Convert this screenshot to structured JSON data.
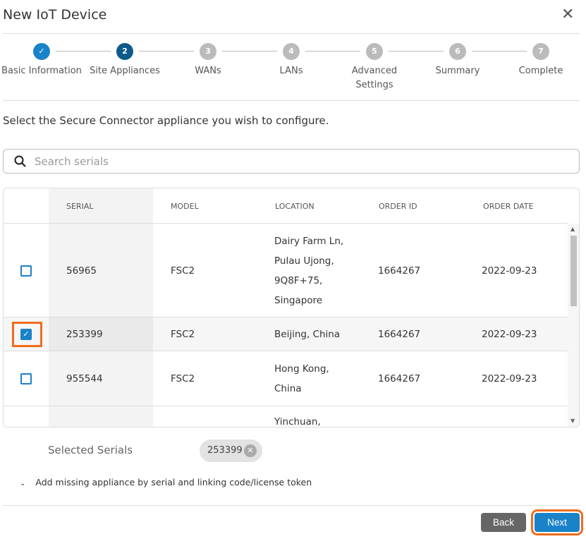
{
  "dialog": {
    "title": "New IoT Device",
    "close_icon": "close-icon"
  },
  "stepper": [
    {
      "num": "✓",
      "label": "Basic Information",
      "state": "done"
    },
    {
      "num": "2",
      "label": "Site Appliances",
      "state": "active"
    },
    {
      "num": "3",
      "label": "WANs",
      "state": "pending"
    },
    {
      "num": "4",
      "label": "LANs",
      "state": "pending"
    },
    {
      "num": "5",
      "label": "Advanced Settings",
      "state": "pending"
    },
    {
      "num": "6",
      "label": "Summary",
      "state": "pending"
    },
    {
      "num": "7",
      "label": "Complete",
      "state": "pending"
    }
  ],
  "prompt": "Select the Secure Connector appliance you wish to configure.",
  "search": {
    "placeholder": "Search serials",
    "value": ""
  },
  "table": {
    "headers": [
      "SERIAL",
      "MODEL",
      "LOCATION",
      "ORDER ID",
      "ORDER DATE"
    ],
    "rows": [
      {
        "checked": false,
        "serial": "56965",
        "model": "FSC2",
        "location": [
          "Dairy Farm Ln,",
          "Pulau Ujong,",
          "9Q8F+75,",
          "Singapore"
        ],
        "order_id": "1664267",
        "order_date": "2022-09-23"
      },
      {
        "checked": true,
        "serial": "253399",
        "model": "FSC2",
        "location": [
          "Beijing, China"
        ],
        "order_id": "1664267",
        "order_date": "2022-09-23"
      },
      {
        "checked": false,
        "serial": "955544",
        "model": "FSC2",
        "location": [
          "Hong Kong,",
          "China"
        ],
        "order_id": "1664267",
        "order_date": "2022-09-23"
      },
      {
        "checked": false,
        "serial": "",
        "model": "",
        "location": [
          "Yinchuan,"
        ],
        "order_id": "",
        "order_date": ""
      }
    ]
  },
  "selected": {
    "label": "Selected Serials",
    "chips": [
      "253399"
    ]
  },
  "add_missing": "Add missing appliance by serial and linking code/license token",
  "footer": {
    "back": "Back",
    "next": "Next"
  },
  "colors": {
    "accent": "#1a82c8",
    "active_step": "#0e5a8a",
    "focus": "#f26b1d"
  }
}
